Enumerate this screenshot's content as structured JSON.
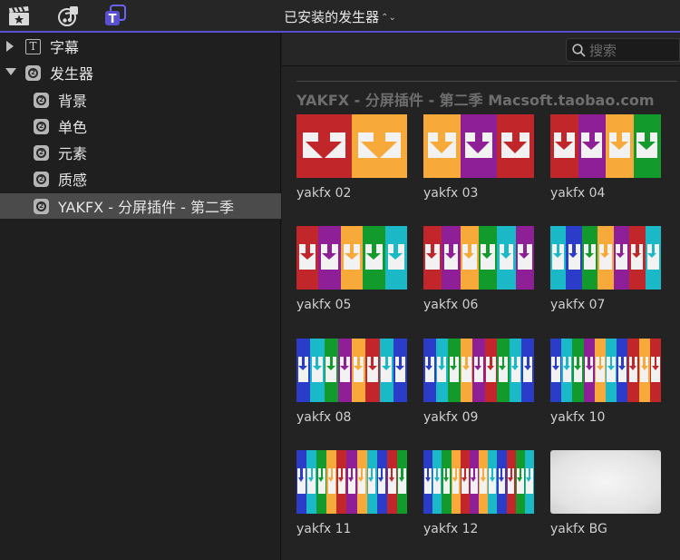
{
  "toolbar": {
    "title": "已安装的发生器",
    "icons": [
      "clapper-star-icon",
      "music-icon",
      "titles-icon"
    ],
    "accent": "#5a4fd0"
  },
  "sidebar": {
    "items": [
      {
        "label": "字幕",
        "icon": "text-icon",
        "expanded": false
      },
      {
        "label": "发生器",
        "icon": "generator-icon",
        "expanded": true
      },
      {
        "label": "背景",
        "icon": "generator-icon"
      },
      {
        "label": "单色",
        "icon": "generator-icon"
      },
      {
        "label": "元素",
        "icon": "generator-icon"
      },
      {
        "label": "质感",
        "icon": "generator-icon"
      },
      {
        "label": "YAKFX - 分屏插件 - 第二季",
        "icon": "generator-icon",
        "selected": true
      }
    ]
  },
  "search": {
    "placeholder": "搜索"
  },
  "section": {
    "title": "YAKFX - 分屏插件 - 第二季 Macsoft.taobao.com"
  },
  "generators": [
    {
      "name": "yakfx 02",
      "colors": [
        "#c0262a",
        "#f7a93a"
      ]
    },
    {
      "name": "yakfx 03",
      "colors": [
        "#f7a93a",
        "#8e1f96",
        "#c0262a"
      ]
    },
    {
      "name": "yakfx 04",
      "colors": [
        "#c0262a",
        "#8e1f96",
        "#f7a93a",
        "#129b2c"
      ]
    },
    {
      "name": "yakfx 05",
      "colors": [
        "#c0262a",
        "#8e1f96",
        "#f7a93a",
        "#129b2c",
        "#1bb8c8"
      ]
    },
    {
      "name": "yakfx 06",
      "colors": [
        "#c0262a",
        "#8e1f96",
        "#f7a93a",
        "#129b2c",
        "#1bb8c8",
        "#8e1f96"
      ]
    },
    {
      "name": "yakfx 07",
      "colors": [
        "#1bb8c8",
        "#2a3cc8",
        "#129b2c",
        "#f7a93a",
        "#8e1f96",
        "#c0262a",
        "#1bb8c8"
      ]
    },
    {
      "name": "yakfx 08",
      "colors": [
        "#2a3cc8",
        "#1bb8c8",
        "#129b2c",
        "#8e1f96",
        "#f7a93a",
        "#c0262a",
        "#1bb8c8",
        "#2a3cc8"
      ]
    },
    {
      "name": "yakfx 09",
      "colors": [
        "#2a3cc8",
        "#1bb8c8",
        "#129b2c",
        "#f7a93a",
        "#8e1f96",
        "#c0262a",
        "#129b2c",
        "#1bb8c8",
        "#2a3cc8"
      ]
    },
    {
      "name": "yakfx 10",
      "colors": [
        "#2a3cc8",
        "#1bb8c8",
        "#129b2c",
        "#8e1f96",
        "#f7a93a",
        "#1bb8c8",
        "#2a3cc8",
        "#c0262a",
        "#f7a93a",
        "#c0262a"
      ]
    },
    {
      "name": "yakfx 11",
      "colors": [
        "#2a3cc8",
        "#1bb8c8",
        "#129b2c",
        "#f7a93a",
        "#c0262a",
        "#8e1f96",
        "#f7a93a",
        "#1bb8c8",
        "#2a3cc8",
        "#c0262a",
        "#129b2c"
      ]
    },
    {
      "name": "yakfx 12",
      "colors": [
        "#2a3cc8",
        "#1bb8c8",
        "#129b2c",
        "#f7a93a",
        "#c0262a",
        "#8e1f96",
        "#f7a93a",
        "#1bb8c8",
        "#2a3cc8",
        "#c0262a",
        "#129b2c",
        "#1bb8c8"
      ]
    },
    {
      "name": "yakfx BG",
      "colors": []
    }
  ]
}
